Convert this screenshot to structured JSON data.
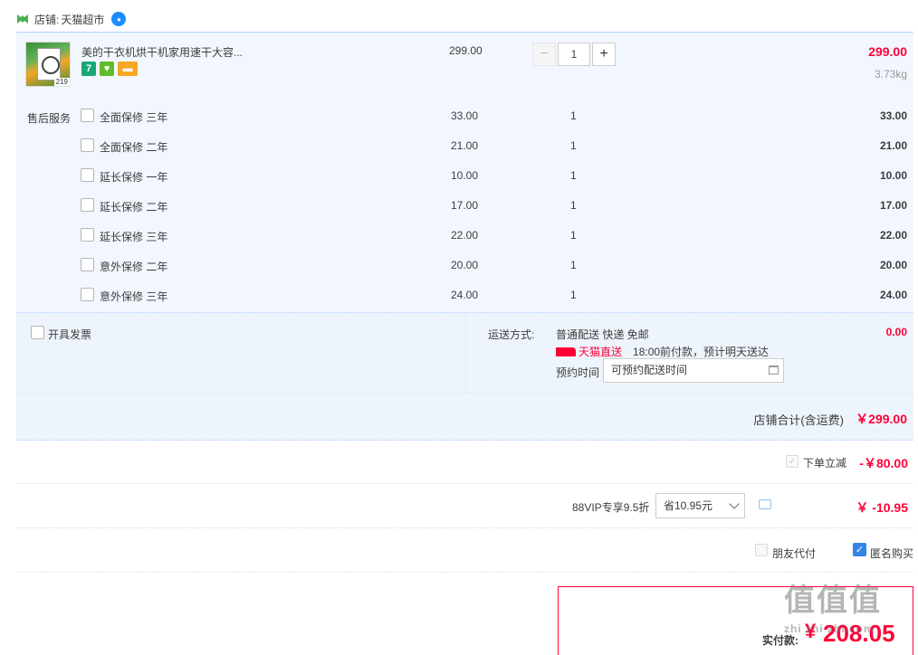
{
  "shop": {
    "prefix": "店铺:",
    "name": "天猫超市"
  },
  "item": {
    "title": "美的干衣机烘干机家用速干大容...",
    "thumb_tag": "219",
    "badges": [
      "7",
      "♥",
      "▬"
    ],
    "unit_price": "299.00",
    "quantity": "1",
    "minus": "−",
    "plus": "+",
    "line_total": "299.00",
    "weight": "3.73kg"
  },
  "services": {
    "label": "售后服务",
    "rows": [
      {
        "name": "全面保修 三年",
        "price": "33.00",
        "qty": "1",
        "total": "33.00"
      },
      {
        "name": "全面保修 二年",
        "price": "21.00",
        "qty": "1",
        "total": "21.00"
      },
      {
        "name": "延长保修 一年",
        "price": "10.00",
        "qty": "1",
        "total": "10.00"
      },
      {
        "name": "延长保修 二年",
        "price": "17.00",
        "qty": "1",
        "total": "17.00"
      },
      {
        "name": "延长保修 三年",
        "price": "22.00",
        "qty": "1",
        "total": "22.00"
      },
      {
        "name": "意外保修 二年",
        "price": "20.00",
        "qty": "1",
        "total": "20.00"
      },
      {
        "name": "意外保修 三年",
        "price": "24.00",
        "qty": "1",
        "total": "24.00"
      }
    ]
  },
  "shipping": {
    "invoice_label": "开具发票",
    "method_label": "运送方式:",
    "method": "普通配送 快递 免邮",
    "fee": "0.00",
    "direct_label": "天猫直送",
    "direct_desc": "18:00前付款，预计明天送达",
    "appt_label": "预约时间",
    "appt_placeholder": "可预约配送时间"
  },
  "shop_total": {
    "label": "店铺合计(含运费)",
    "value": "￥299.00"
  },
  "promo": {
    "label": "下单立减",
    "value": "-￥80.00",
    "check": "✓"
  },
  "vip": {
    "label": "88VIP专享9.5折",
    "selected": "省10.95元",
    "value": "￥ -10.95"
  },
  "options": {
    "friend_pay": "朋友代付",
    "anonymous": "匿名购买",
    "anon_check": "✓"
  },
  "payment": {
    "label": "实付款:",
    "currency": "¥",
    "amount": "208.05"
  },
  "watermark": {
    "main": "值值值",
    "sub": "zhi zhi zhi.com"
  },
  "colors": {
    "accent": "#ff0036",
    "panel": "#f2f7ff",
    "checkbox_checked": "#3385e6"
  }
}
